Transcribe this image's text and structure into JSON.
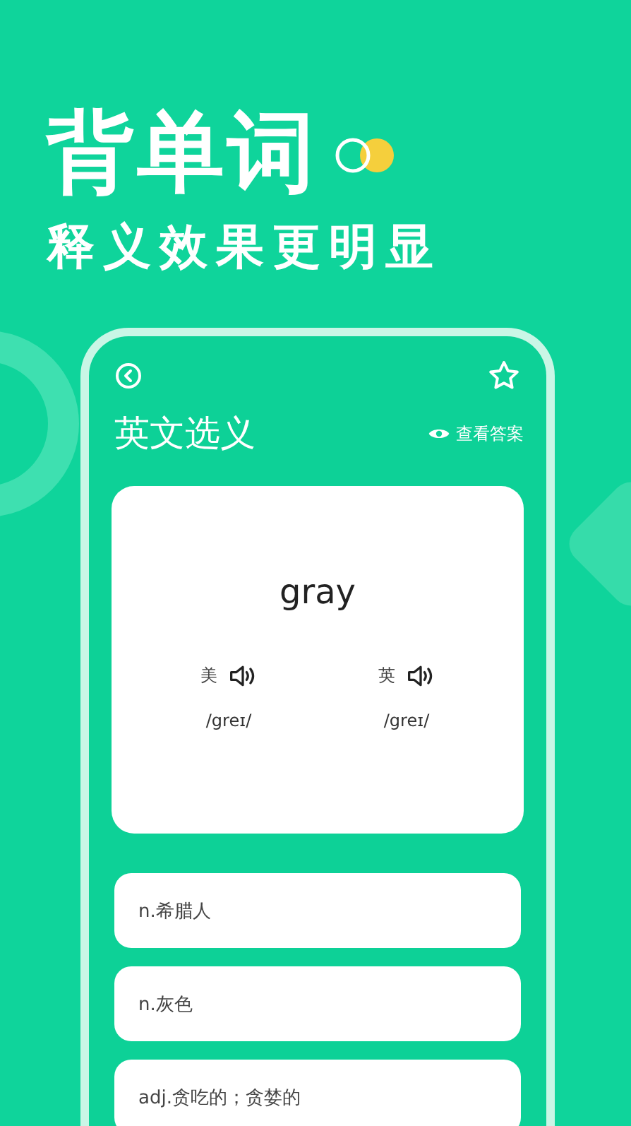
{
  "headline": "背单词",
  "subtitle": "释义效果更明显",
  "screen": {
    "title": "英文选义",
    "show_answer": "查看答案",
    "word": "gray",
    "pronunciations": [
      {
        "region": "美",
        "phonetic": "/greɪ/"
      },
      {
        "region": "英",
        "phonetic": "/greɪ/"
      }
    ],
    "options": [
      {
        "text": "n.希腊人"
      },
      {
        "text": "n.灰色"
      },
      {
        "text": "adj.贪吃的；贪婪的"
      }
    ]
  }
}
